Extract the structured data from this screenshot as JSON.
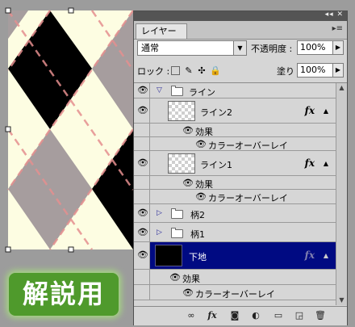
{
  "canvas": {
    "badge_text": "解説用",
    "colors": {
      "cream": "#fdfde2",
      "black": "#000000",
      "gray": "#a69d9e",
      "stitch": "#e58f8f",
      "badge_green": "#4f9a2c"
    }
  },
  "panel": {
    "tab_label": "レイヤー",
    "title_controls": "◂◂ ✕",
    "menu_icon": "▸≡",
    "blend_mode": "通常",
    "opacity_label": "不透明度 :",
    "opacity_value": "100%",
    "lock_label": "ロック :",
    "fill_label": "塗り :",
    "fill_value": "100%",
    "layers": [
      {
        "kind": "group",
        "name": "ライン",
        "expanded": true,
        "visible": true
      },
      {
        "kind": "layer",
        "name": "ライン2",
        "visible": true,
        "has_fx": true,
        "thumb": "transparent"
      },
      {
        "kind": "effects",
        "label": "効果"
      },
      {
        "kind": "effect",
        "label": "カラーオーバーレイ"
      },
      {
        "kind": "layer",
        "name": "ライン1",
        "visible": true,
        "has_fx": true,
        "thumb": "transparent"
      },
      {
        "kind": "effects",
        "label": "効果"
      },
      {
        "kind": "effect",
        "label": "カラーオーバーレイ"
      },
      {
        "kind": "group",
        "name": "柄2",
        "expanded": false,
        "visible": true
      },
      {
        "kind": "group",
        "name": "柄1",
        "expanded": false,
        "visible": true
      },
      {
        "kind": "layer",
        "name": "下地",
        "visible": true,
        "has_fx": true,
        "thumb": "black",
        "selected": true
      },
      {
        "kind": "effects",
        "label": "効果"
      },
      {
        "kind": "effect",
        "label": "カラーオーバーレイ"
      }
    ],
    "fx_label": "fx",
    "footer_icons": [
      "link-icon",
      "fx-icon",
      "mask-icon",
      "adjustment-icon",
      "new-group-icon",
      "new-layer-icon",
      "trash-icon"
    ],
    "selected_color": "#000a82"
  }
}
